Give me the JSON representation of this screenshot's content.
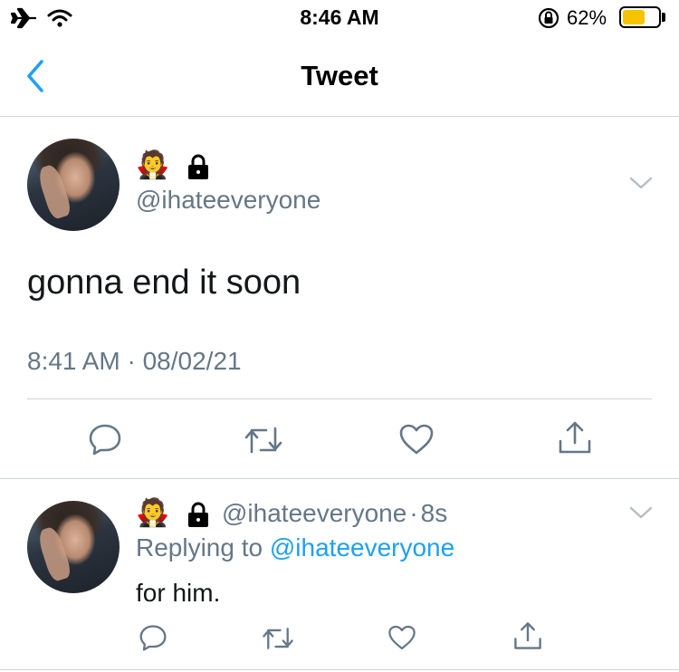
{
  "status_bar": {
    "time": "8:46 AM",
    "battery_percent": "62%",
    "battery_level": 0.62,
    "icons": [
      "airplane-icon",
      "wifi-icon",
      "rotation-lock-icon",
      "battery-icon"
    ]
  },
  "nav": {
    "title": "Tweet",
    "back_icon": "chevron-left-icon"
  },
  "tweet": {
    "name_emoji": "🧛",
    "lock_icon": "lock-icon",
    "handle": "@ihateeveryone",
    "text": "gonna end it soon",
    "timestamp": "8:41 AM · 08/02/21",
    "actions": [
      "reply-icon",
      "retweet-icon",
      "like-icon",
      "share-icon"
    ]
  },
  "reply": {
    "name_emoji": "🧛",
    "handle": "@ihateeveryone",
    "separator": "·",
    "age": "8s",
    "replying_to_label": "Replying to",
    "replying_to_handle": "@ihateeveryone",
    "text": "for him.",
    "actions": [
      "reply-icon",
      "retweet-icon",
      "like-icon",
      "share-icon"
    ]
  },
  "colors": {
    "accent": "#1da1f2",
    "muted": "#657786",
    "text": "#14171a",
    "divider": "#d0d3d6",
    "icon": "#657786",
    "battery_fill": "#f5c400"
  }
}
